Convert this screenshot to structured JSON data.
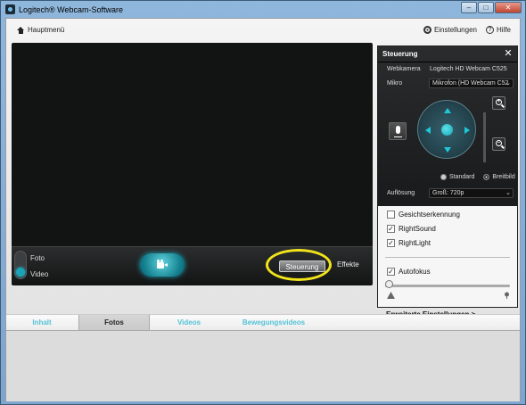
{
  "window": {
    "title": "Logitech® Webcam-Software"
  },
  "topnav": {
    "home_label": "Hauptmenü",
    "settings_label": "Einstellungen",
    "help_label": "Hilfe"
  },
  "bottombar": {
    "mode_photo": "Foto",
    "mode_video": "Video",
    "selected_mode": "Video",
    "steuerung_label": "Steuerung",
    "effekte_label": "Effekte"
  },
  "panel": {
    "title": "Steuerung",
    "webcam_label": "Webkamera",
    "webcam_value": "Logitech HD Webcam C525",
    "mic_label": "Mikro",
    "mic_value": "Mikrofon (HD Webcam C52",
    "aspect_standard": "Standard",
    "aspect_wide": "Breitbild",
    "aspect_selected": "Breitbild",
    "resolution_label": "Auflösung",
    "resolution_value": "Groß: 720p",
    "face_detection_label": "Gesichtserkennung",
    "face_detection_checked": false,
    "rightsound_label": "RightSound",
    "rightsound_checked": true,
    "rightlight_label": "RightLight",
    "rightlight_checked": true,
    "autofocus_label": "Autofokus",
    "autofocus_checked": true,
    "advanced_link": "Erweiterte Einstellungen >"
  },
  "tabs": [
    {
      "label": "Inhalt",
      "active": false
    },
    {
      "label": "Fotos",
      "active": true
    },
    {
      "label": "Videos",
      "active": false
    },
    {
      "label": "Bewegungsvideos",
      "active": false
    }
  ],
  "colors": {
    "accent": "#1aa3b8",
    "tab_inactive": "#54c2d6",
    "highlight_ring": "#f2e41a"
  }
}
